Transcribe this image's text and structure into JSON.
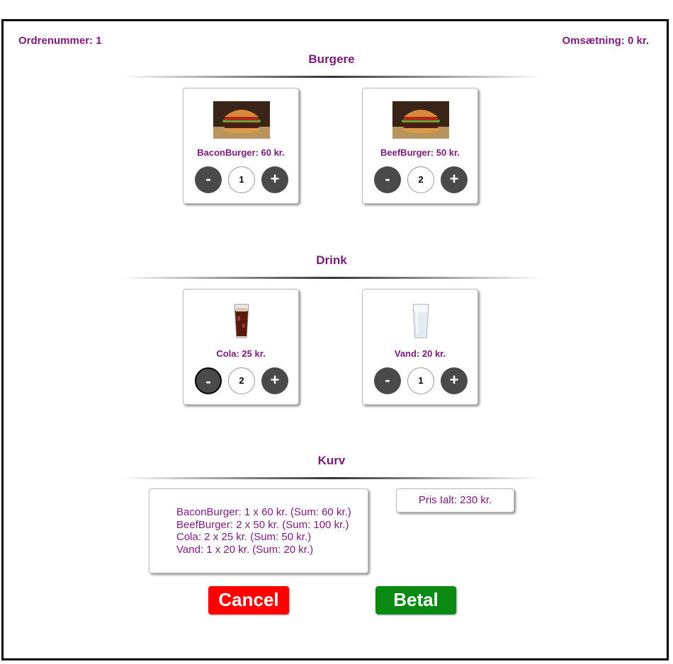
{
  "header": {
    "order_number": "Ordrenummer: 1",
    "revenue": "Omsætning: 0 kr."
  },
  "sections": {
    "burgers": {
      "title": "Burgere",
      "items": [
        {
          "price_label": "BaconBurger: 60 kr.",
          "qty": "1",
          "minus": "-",
          "plus": "+"
        },
        {
          "price_label": "BeefBurger: 50 kr.",
          "qty": "2",
          "minus": "-",
          "plus": "+"
        }
      ]
    },
    "drinks": {
      "title": "Drink",
      "items": [
        {
          "price_label": "Cola: 25 kr.",
          "qty": "2",
          "minus": "-",
          "plus": "+"
        },
        {
          "price_label": "Vand: 20 kr.",
          "qty": "1",
          "minus": "-",
          "plus": "+"
        }
      ]
    },
    "basket": {
      "title": "Kurv",
      "lines": [
        "BaconBurger: 1 x 60 kr. (Sum: 60 kr.)",
        "BeefBurger: 2 x 50 kr. (Sum: 100 kr.)",
        "Cola: 2 x 25 kr. (Sum: 50 kr.)",
        "Vand: 1 x 20 kr. (Sum: 20 kr.)"
      ],
      "total": "Pris Ialt: 230 kr."
    }
  },
  "actions": {
    "cancel_label": "Cancel",
    "pay_label": "Betal"
  },
  "colors": {
    "accent": "#7a1a7a",
    "cancel": "#ff0000",
    "pay": "#0a8a12",
    "button_dark": "#4a4a4a"
  }
}
